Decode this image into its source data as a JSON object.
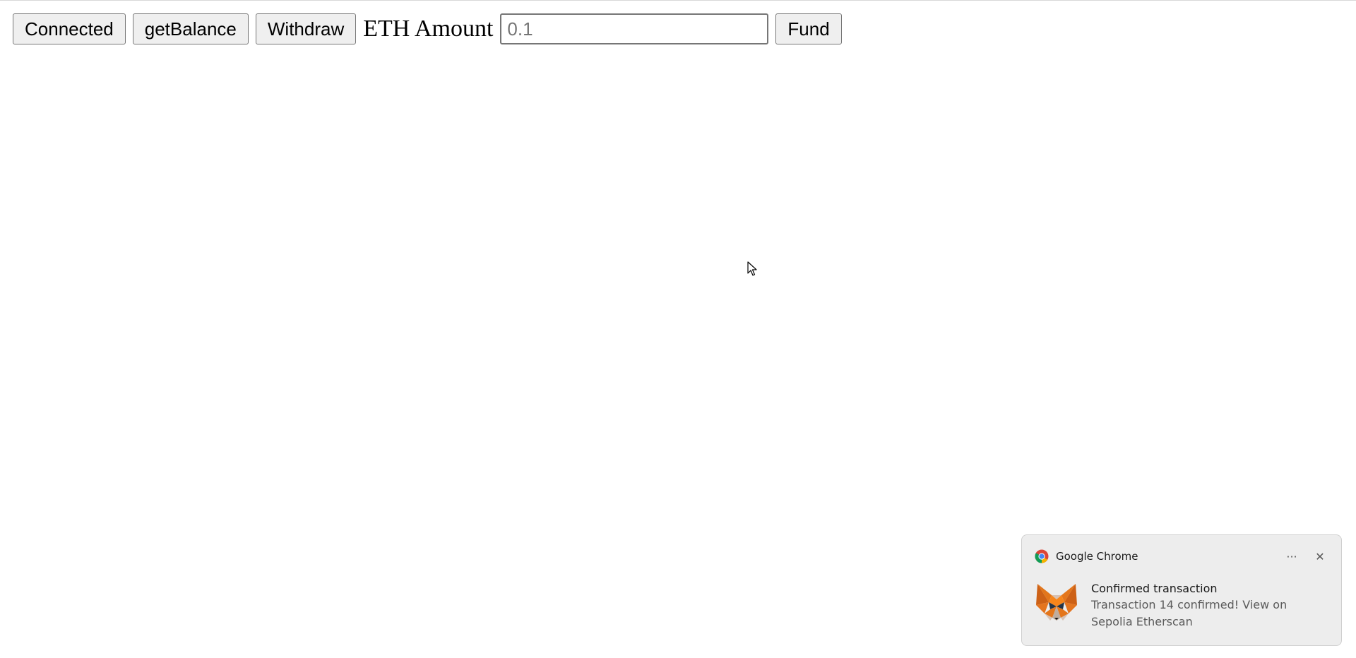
{
  "toolbar": {
    "connect_label": "Connected",
    "get_balance_label": "getBalance",
    "withdraw_label": "Withdraw",
    "eth_amount_label": "ETH Amount",
    "eth_amount_placeholder": "0.1",
    "eth_amount_value": "",
    "fund_label": "Fund"
  },
  "notification": {
    "app_name": "Google Chrome",
    "more_options_glyph": "···",
    "close_glyph": "✕",
    "title": "Confirmed transaction",
    "message": "Transaction 14 confirmed! View on Sepolia Etherscan",
    "app_icon": "chrome-icon",
    "content_icon": "metamask-fox-icon",
    "background_color": "#ededed"
  }
}
